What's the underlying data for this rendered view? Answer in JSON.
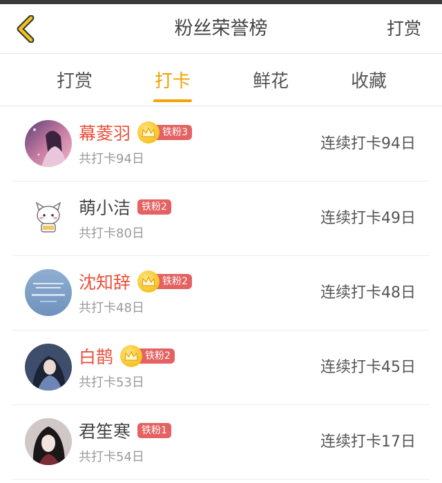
{
  "header": {
    "title": "粉丝荣誉榜",
    "right_label": "打赏"
  },
  "colors": {
    "accent": "#f5a300",
    "vip_name": "#e8503a",
    "level_badge": "#e46262",
    "crown": "#f2b600"
  },
  "tabs": [
    {
      "label": "打赏",
      "active": false
    },
    {
      "label": "打卡",
      "active": true
    },
    {
      "label": "鲜花",
      "active": false
    },
    {
      "label": "收藏",
      "active": false
    }
  ],
  "fans": [
    {
      "name": "幕菱羽",
      "vip": true,
      "level": "铁粉3",
      "total": "共打卡94日",
      "streak": "连续打卡94日",
      "avatar": "avatar-girl-purple"
    },
    {
      "name": "萌小洁",
      "vip": false,
      "level": "铁粉2",
      "total": "共打卡80日",
      "streak": "连续打卡49日",
      "avatar": "avatar-cartoon-cat"
    },
    {
      "name": "沈知辞",
      "vip": true,
      "level": "铁粉2",
      "total": "共打卡48日",
      "streak": "连续打卡48日",
      "avatar": "avatar-nine-percent"
    },
    {
      "name": "白鹊",
      "vip": true,
      "level": "铁粉2",
      "total": "共打卡53日",
      "streak": "连续打卡45日",
      "avatar": "avatar-anime-boy"
    },
    {
      "name": "君笙寒",
      "vip": false,
      "level": "铁粉1",
      "total": "共打卡54日",
      "streak": "连续打卡17日",
      "avatar": "avatar-anime-girl"
    }
  ]
}
